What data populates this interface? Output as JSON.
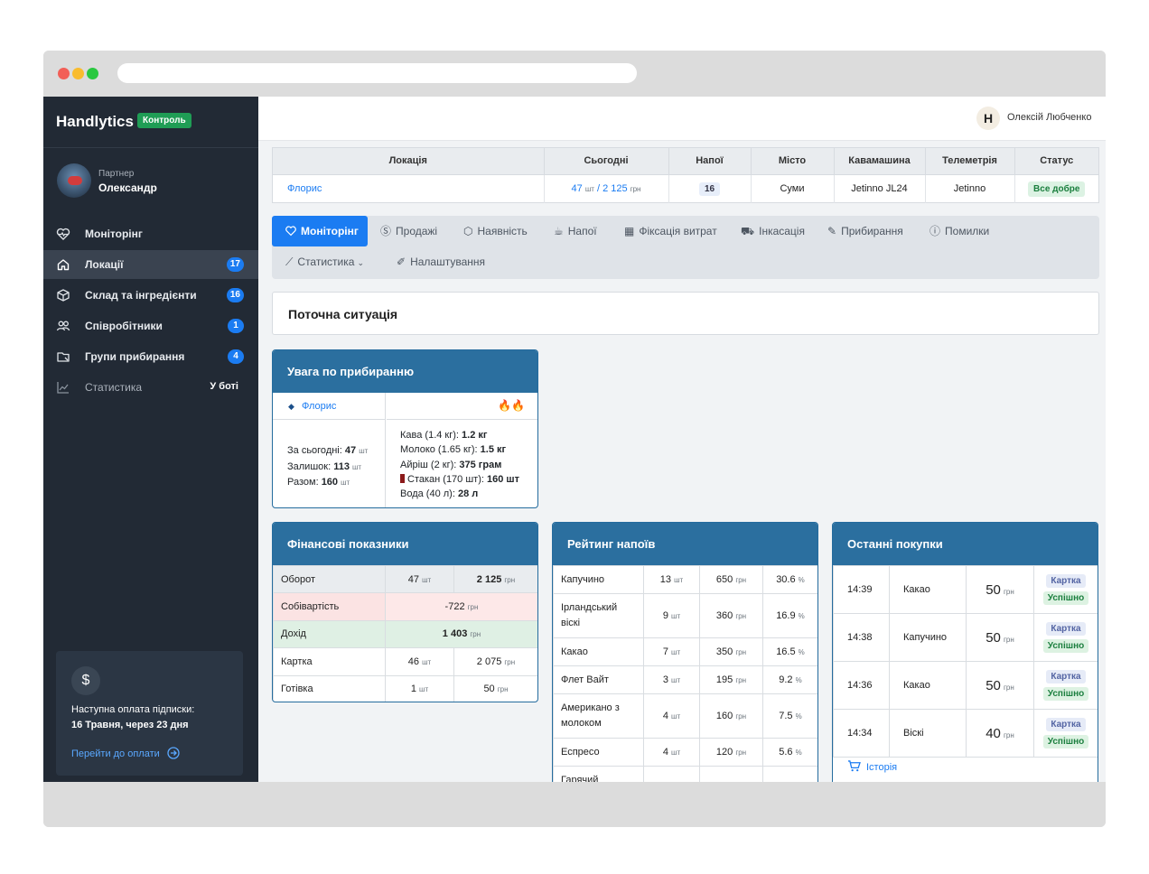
{
  "app": {
    "brand": "Handlytics",
    "badge": "Контроль"
  },
  "partner": {
    "role": "Партнер",
    "name": "Олександр"
  },
  "sidebar": {
    "items": [
      {
        "label": "Моніторінг",
        "icon": "heart-monitor-icon",
        "count": ""
      },
      {
        "label": "Локації",
        "icon": "home-icon",
        "count": "17"
      },
      {
        "label": "Склад та інгредієнти",
        "icon": "box-icon",
        "count": "16"
      },
      {
        "label": "Співробітники",
        "icon": "users-icon",
        "count": "1"
      },
      {
        "label": "Групи прибирання",
        "icon": "cleaning-group-icon",
        "count": "4"
      },
      {
        "label": "Статистика",
        "icon": "chart-icon",
        "soon": "У боті"
      }
    ]
  },
  "subscription": {
    "symbol": "$",
    "line1": "Наступна оплата підписки:",
    "line2": "16 Травня, через 23 дня",
    "link": "Перейти до оплати"
  },
  "user": {
    "logo": "H",
    "name": "Олексій Любченко"
  },
  "location_table": {
    "headers": [
      "Локація",
      "Сьогодні",
      "Напої",
      "Місто",
      "Кавамашина",
      "Телеметрія",
      "Статус"
    ],
    "row": {
      "location": "Флорис",
      "today_count": "47",
      "today_count_unit": "шт",
      "today_sep": " / ",
      "today_sum": "2 125",
      "today_sum_unit": "грн",
      "drinks": "16",
      "city": "Суми",
      "machine": "Jetinno JL24",
      "telemetry": "Jetinno",
      "status": "Все добре"
    }
  },
  "tabs": [
    {
      "label": "Моніторінг",
      "icon": "heart-monitor-icon"
    },
    {
      "label": "Продажі",
      "icon": "dollar-icon"
    },
    {
      "label": "Наявність",
      "icon": "box-icon"
    },
    {
      "label": "Напої",
      "icon": "cup-icon"
    },
    {
      "label": "Фіксація витрат",
      "icon": "calculator-icon"
    },
    {
      "label": "Інкасація",
      "icon": "car-icon"
    },
    {
      "label": "Прибирання",
      "icon": "brush-icon"
    },
    {
      "label": "Помилки",
      "icon": "alert-icon"
    },
    {
      "label": "Статистика",
      "icon": "chart-icon"
    },
    {
      "label": "Налаштування",
      "icon": "pencil-icon"
    }
  ],
  "current_situation": "Поточна ситуація",
  "cleaning": {
    "title": "Увага по прибиранню",
    "location": "Флорис",
    "fire": "🔥🔥",
    "stats": [
      {
        "label": "За сьогодні:",
        "value": "47",
        "unit": "шт"
      },
      {
        "label": "Залишок:",
        "value": "113",
        "unit": "шт"
      },
      {
        "label": "Разом:",
        "value": "160",
        "unit": "шт"
      }
    ],
    "ingredients": [
      {
        "label": "Кава (1.4 кг):",
        "value": "1.2 кг"
      },
      {
        "label": "Молоко (1.65 кг):",
        "value": "1.5 кг"
      },
      {
        "label": "Айріш (2 кг):",
        "value": "375 грам"
      },
      {
        "label": "Стакан (170 шт):",
        "value": "160 шт"
      },
      {
        "label": "Вода (40 л):",
        "value": "28 л"
      }
    ]
  },
  "finance": {
    "title": "Фінансові показники",
    "rows": [
      {
        "label": "Оборот",
        "count": "47",
        "count_unit": "шт",
        "sum": "2 125",
        "sum_unit": "грн"
      },
      {
        "label": "Собівартість",
        "sum": "-722",
        "sum_unit": "грн"
      },
      {
        "label": "Дохід",
        "sum": "1 403",
        "sum_unit": "грн"
      },
      {
        "label": "Картка",
        "count": "46",
        "count_unit": "шт",
        "sum": "2 075",
        "sum_unit": "грн"
      },
      {
        "label": "Готівка",
        "count": "1",
        "count_unit": "шт",
        "sum": "50",
        "sum_unit": "грн"
      }
    ]
  },
  "rating": {
    "title": "Рейтинг напоїв",
    "unit_count": "шт",
    "unit_sum": "грн",
    "unit_pct": "%",
    "rows": [
      {
        "name": "Капучино",
        "count": "13",
        "sum": "650",
        "pct": "30.6"
      },
      {
        "name": "Ірландський віскі",
        "count": "9",
        "sum": "360",
        "pct": "16.9"
      },
      {
        "name": "Какао",
        "count": "7",
        "sum": "350",
        "pct": "16.5"
      },
      {
        "name": "Флет Вайт",
        "count": "3",
        "sum": "195",
        "pct": "9.2"
      },
      {
        "name": "Американо з молоком",
        "count": "4",
        "sum": "160",
        "pct": "7.5"
      },
      {
        "name": "Еспресо",
        "count": "4",
        "sum": "120",
        "pct": "5.6"
      },
      {
        "name": "Гарячий",
        "count": "",
        "sum": "",
        "pct": ""
      }
    ]
  },
  "purchases": {
    "title": "Останні покупки",
    "unit": "грн",
    "rows": [
      {
        "time": "14:39",
        "name": "Какао",
        "price": "50",
        "method": "Картка",
        "status": "Успішно"
      },
      {
        "time": "14:38",
        "name": "Капучино",
        "price": "50",
        "method": "Картка",
        "status": "Успішно"
      },
      {
        "time": "14:36",
        "name": "Какао",
        "price": "50",
        "method": "Картка",
        "status": "Успішно"
      },
      {
        "time": "14:34",
        "name": "Віскі",
        "price": "40",
        "method": "Картка",
        "status": "Успішно"
      }
    ],
    "history_link": "Історія"
  },
  "colors": {
    "accent": "#1b7cf2",
    "sidebar": "#222a35",
    "card_header": "#2b6f9f",
    "success": "#1f9d55"
  }
}
